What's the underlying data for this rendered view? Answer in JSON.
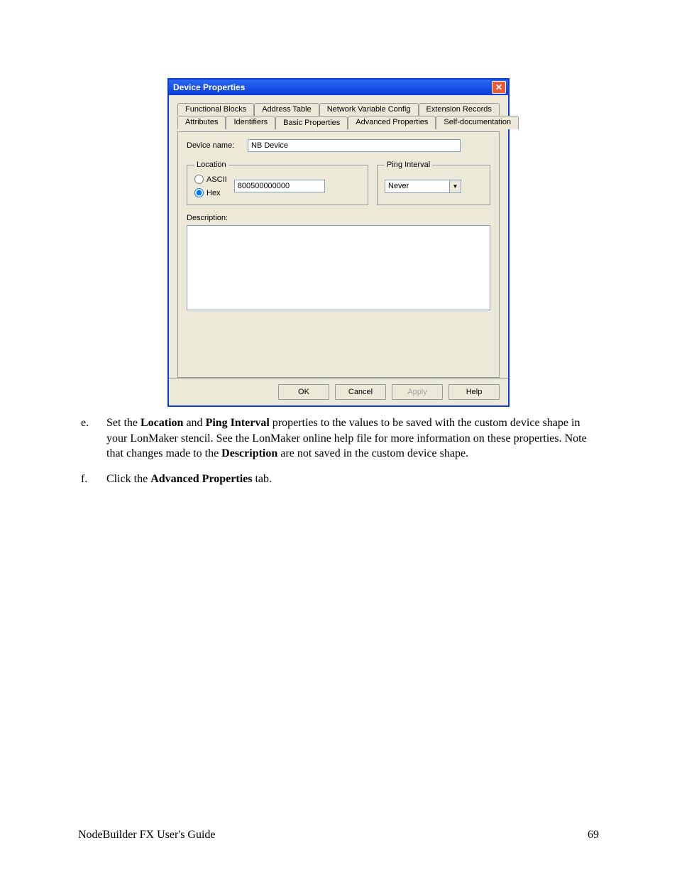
{
  "dialog": {
    "title": "Device Properties",
    "tabs_row1": [
      "Functional Blocks",
      "Address Table",
      "Network Variable Config",
      "Extension Records"
    ],
    "tabs_row2": [
      "Attributes",
      "Identifiers",
      "Basic Properties",
      "Advanced Properties",
      "Self-documentation"
    ],
    "active_tab": "Basic Properties",
    "device_name_label": "Device name:",
    "device_name_value": "NB Device",
    "location_legend": "Location",
    "radio_ascii": "ASCII",
    "radio_hex": "Hex",
    "location_value": "800500000000",
    "ping_legend": "Ping Interval",
    "ping_value": "Never",
    "description_label": "Description:",
    "description_value": "",
    "buttons": {
      "ok": "OK",
      "cancel": "Cancel",
      "apply": "Apply",
      "help": "Help"
    }
  },
  "steps": {
    "e": {
      "marker": "e.",
      "text_before": "Set the ",
      "b1": "Location",
      "mid1": " and ",
      "b2": "Ping Interval",
      "mid2": " properties to the values to be saved with the custom device shape in your LonMaker stencil.  See the LonMaker online help file for more information on these properties.  Note that changes made to the ",
      "b3": "Description",
      "after": " are not saved in the custom device shape."
    },
    "f": {
      "marker": "f.",
      "text_before": "Click the ",
      "b1": "Advanced Properties",
      "after": " tab."
    }
  },
  "footer": {
    "left": "NodeBuilder FX User's Guide",
    "right": "69"
  }
}
